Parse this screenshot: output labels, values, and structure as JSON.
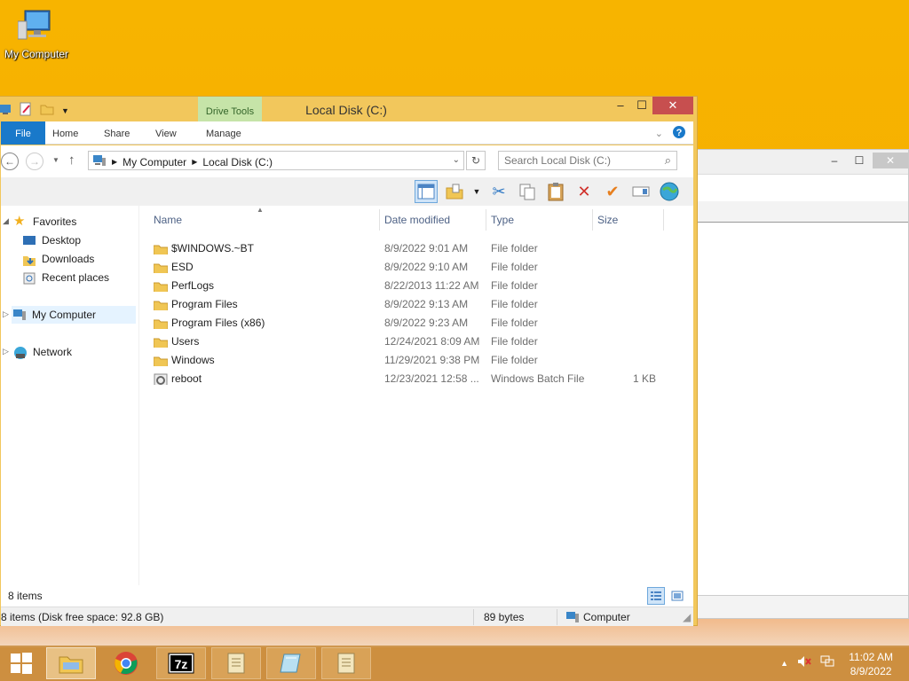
{
  "desktop": {
    "icon_label": "My Computer"
  },
  "window": {
    "title": "Local Disk (C:)",
    "contextual_tab": "Drive Tools",
    "ribbon_tabs": [
      "File",
      "Home",
      "Share",
      "View",
      "Manage"
    ],
    "min_glyph": "‒",
    "max_glyph": "☐",
    "close_glyph": "✕"
  },
  "address": {
    "crumbs": [
      "My Computer",
      "Local Disk (C:)"
    ],
    "search_placeholder": "Search Local Disk (C:)"
  },
  "nav": {
    "favorites": "Favorites",
    "desktop": "Desktop",
    "downloads": "Downloads",
    "recent": "Recent places",
    "computer": "My Computer",
    "network": "Network"
  },
  "columns": {
    "name": "Name",
    "date": "Date modified",
    "type": "Type",
    "size": "Size"
  },
  "files": [
    {
      "name": "$WINDOWS.~BT",
      "date": "8/9/2022 9:01 AM",
      "type": "File folder",
      "size": ""
    },
    {
      "name": "ESD",
      "date": "8/9/2022 9:10 AM",
      "type": "File folder",
      "size": ""
    },
    {
      "name": "PerfLogs",
      "date": "8/22/2013 11:22 AM",
      "type": "File folder",
      "size": ""
    },
    {
      "name": "Program Files",
      "date": "8/9/2022 9:13 AM",
      "type": "File folder",
      "size": ""
    },
    {
      "name": "Program Files (x86)",
      "date": "8/9/2022 9:23 AM",
      "type": "File folder",
      "size": ""
    },
    {
      "name": "Users",
      "date": "12/24/2021 8:09 AM",
      "type": "File folder",
      "size": ""
    },
    {
      "name": "Windows",
      "date": "11/29/2021 9:38 PM",
      "type": "File folder",
      "size": ""
    },
    {
      "name": "reboot",
      "date": "12/23/2021 12:58 ...",
      "type": "Windows Batch File",
      "size": "1 KB"
    }
  ],
  "status": {
    "item_count": "8 items",
    "details": "8 items (Disk free space: 92.8 GB)",
    "size": "89 bytes",
    "location": "Computer"
  },
  "taskbar": {
    "time": "11:02 AM",
    "date": "8/9/2022"
  },
  "colors": {
    "accent": "#1979ca",
    "desktop": "#f7b400",
    "close": "#c74f4f",
    "contextual": "#c6e4a8"
  }
}
